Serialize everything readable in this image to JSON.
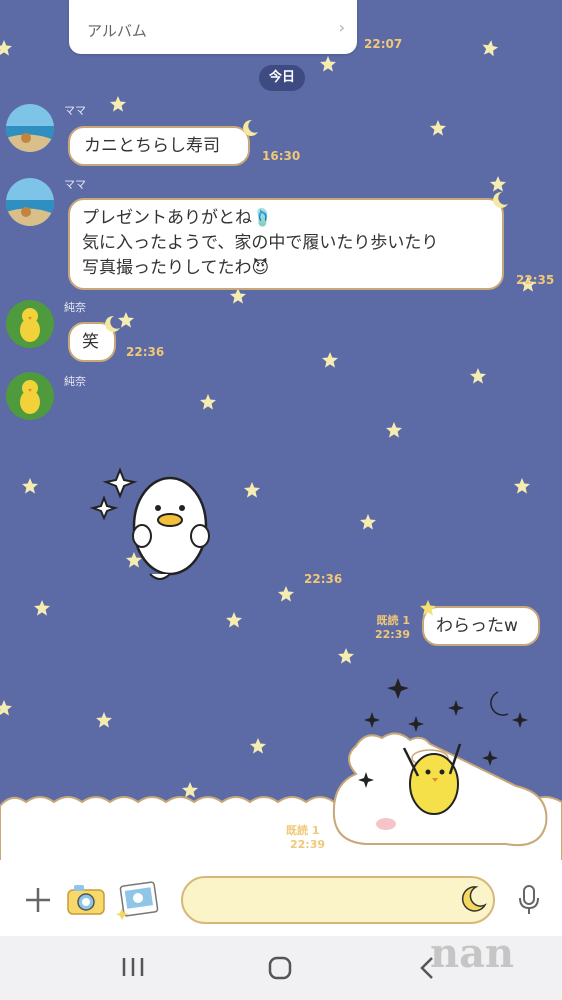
{
  "album": {
    "label": "アルバム",
    "chevron": "›",
    "time": "22:07"
  },
  "date_separator": "今日",
  "messages": [
    {
      "sender": "ママ",
      "lines": [
        "カニとちらし寿司"
      ],
      "time": "16:30"
    },
    {
      "sender": "ママ",
      "lines": [
        "プレゼントありがとね🩴",
        "気に入ったようで、家の中で履いたり歩いたり",
        "写真撮ったりしてたわ😈"
      ],
      "time": "22:35"
    },
    {
      "sender": "純奈",
      "lines": [
        "笑"
      ],
      "time": "22:36"
    },
    {
      "sender": "純奈",
      "sticker": "penguin-thumbs-up-sticker",
      "time": "22:36"
    }
  ],
  "outgoing": [
    {
      "read": "既読 1",
      "time": "22:39",
      "text": "わらったw"
    },
    {
      "read": "既読 1",
      "time": "22:39",
      "sticker": "chick-cloud-sticker"
    }
  ],
  "input": {
    "icons": [
      "plus-icon",
      "camera-icon",
      "photo-icon",
      "moon-icon",
      "mic-icon"
    ]
  },
  "nav": {
    "icons": [
      "recent-apps-icon",
      "home-icon",
      "back-icon"
    ]
  },
  "watermark": "nan",
  "colors": {
    "background": "#5c6aa5",
    "bubble_border": "#c8a878",
    "time_text": "#f0c878",
    "input_bg": "#fbf4c8"
  }
}
